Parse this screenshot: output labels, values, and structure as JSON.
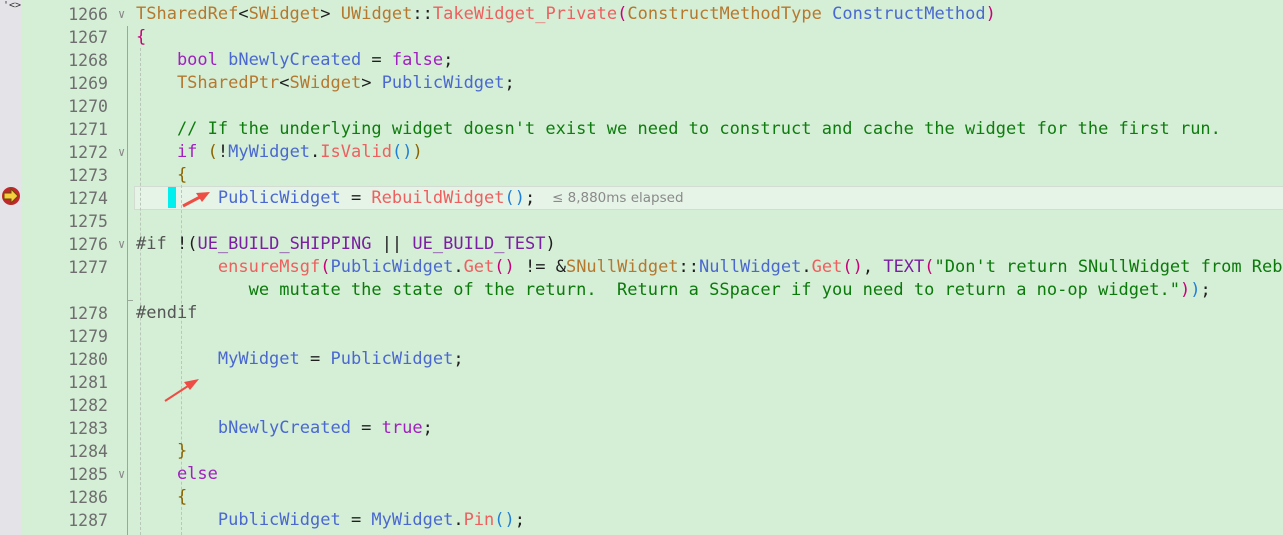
{
  "gutter_tag": "'<>",
  "elapsed_hint": "≤ 8,880ms elapsed",
  "icons": {
    "current_statement": "breakpoint-arrow-icon",
    "fold": "chevron-down-icon",
    "annotation": "red-arrow-icon"
  },
  "colors": {
    "background": "#d5eed6",
    "current_line": "#e6f3e7",
    "cursor_marker": "#00f0f0",
    "annotation_arrow": "#ee4c44"
  },
  "current_line": "1274",
  "lines": [
    {
      "n": "1266",
      "fold": true,
      "tokens": [
        [
          "TSharedRef",
          "t"
        ],
        [
          "<",
          "p"
        ],
        [
          "SWidget",
          "t"
        ],
        [
          "> ",
          "p"
        ],
        [
          "UWidget",
          "t"
        ],
        [
          "::",
          "p"
        ],
        [
          "TakeWidget_Private",
          "f"
        ],
        [
          "(",
          "b1"
        ],
        [
          "ConstructMethodType",
          "t"
        ],
        [
          " ",
          "p"
        ],
        [
          "ConstructMethod",
          "v"
        ],
        [
          ")",
          "b1"
        ]
      ]
    },
    {
      "n": "1267",
      "tokens": [
        [
          "{",
          "b1"
        ]
      ]
    },
    {
      "n": "1268",
      "tokens": [
        [
          "    bool ",
          "k"
        ],
        [
          "bNewlyCreated",
          "v"
        ],
        [
          " = ",
          "p"
        ],
        [
          "false",
          "k"
        ],
        [
          ";",
          "p"
        ]
      ]
    },
    {
      "n": "1269",
      "tokens": [
        [
          "    TSharedPtr",
          "t"
        ],
        [
          "<",
          "p"
        ],
        [
          "SWidget",
          "t"
        ],
        [
          "> ",
          "p"
        ],
        [
          "PublicWidget",
          "v"
        ],
        [
          ";",
          "p"
        ]
      ]
    },
    {
      "n": "1270",
      "tokens": []
    },
    {
      "n": "1271",
      "tokens": [
        [
          "    // If the underlying widget doesn't exist we need to construct and cache the widget for the first run.",
          "c"
        ]
      ]
    },
    {
      "n": "1272",
      "fold": true,
      "tokens": [
        [
          "    if ",
          "k"
        ],
        [
          "(",
          "b2"
        ],
        [
          "!",
          "p"
        ],
        [
          "MyWidget",
          "v"
        ],
        [
          ".",
          "p"
        ],
        [
          "IsValid",
          "f"
        ],
        [
          "()",
          "b3"
        ],
        [
          ")",
          "b2"
        ]
      ]
    },
    {
      "n": "1273",
      "tokens": [
        [
          "    {",
          "b2"
        ]
      ]
    },
    {
      "n": "1274",
      "tokens": [
        [
          "        PublicWidget",
          "v"
        ],
        [
          " = ",
          "p"
        ],
        [
          "RebuildWidget",
          "f"
        ],
        [
          "()",
          "b3"
        ],
        [
          ";",
          "p"
        ]
      ]
    },
    {
      "n": "1275",
      "tokens": []
    },
    {
      "n": "1276",
      "fold": true,
      "tokens": [
        [
          "#if ",
          "pp"
        ],
        [
          "!",
          "p"
        ],
        [
          "(",
          "p"
        ],
        [
          "UE_BUILD_SHIPPING",
          "m"
        ],
        [
          " || ",
          "p"
        ],
        [
          "UE_BUILD_TEST",
          "m"
        ],
        [
          ")",
          "p"
        ]
      ]
    },
    {
      "n": "1277",
      "tokens": [
        [
          "        ensureMsgf",
          "f"
        ],
        [
          "(",
          "b1"
        ],
        [
          "PublicWidget",
          "v"
        ],
        [
          ".",
          "p"
        ],
        [
          "Get",
          "f"
        ],
        [
          "()",
          "b1"
        ],
        [
          " != &",
          "p"
        ],
        [
          "SNullWidget",
          "t"
        ],
        [
          "::",
          "p"
        ],
        [
          "NullWidget",
          "v"
        ],
        [
          ".",
          "p"
        ],
        [
          "Get",
          "f"
        ],
        [
          "()",
          "b1"
        ],
        [
          ", ",
          "p"
        ],
        [
          "TEXT",
          "m"
        ],
        [
          "(",
          "b1"
        ],
        [
          "\"Don't return SNullWidget from Reb",
          "s"
        ]
      ]
    },
    {
      "n": "",
      "tokens": [
        [
          "           we mutate the state of the return.  Return a SSpacer if you need to return a no-op widget.\"",
          "s"
        ],
        [
          ")",
          "b1"
        ],
        [
          ")",
          "b3"
        ],
        [
          ";",
          "p"
        ]
      ]
    },
    {
      "n": "1278",
      "tokens": [
        [
          "#endif",
          "pp"
        ]
      ]
    },
    {
      "n": "1279",
      "tokens": []
    },
    {
      "n": "1280",
      "tokens": [
        [
          "        MyWidget",
          "v"
        ],
        [
          " = ",
          "p"
        ],
        [
          "PublicWidget",
          "v"
        ],
        [
          ";",
          "p"
        ]
      ]
    },
    {
      "n": "1281",
      "tokens": []
    },
    {
      "n": "1282",
      "tokens": []
    },
    {
      "n": "1283",
      "tokens": [
        [
          "        bNewlyCreated",
          "v"
        ],
        [
          " = ",
          "p"
        ],
        [
          "true",
          "k"
        ],
        [
          ";",
          "p"
        ]
      ]
    },
    {
      "n": "1284",
      "tokens": [
        [
          "    }",
          "b2"
        ]
      ]
    },
    {
      "n": "1285",
      "fold": true,
      "tokens": [
        [
          "    else",
          "k"
        ]
      ]
    },
    {
      "n": "1286",
      "tokens": [
        [
          "    {",
          "b2"
        ]
      ]
    },
    {
      "n": "1287",
      "tokens": [
        [
          "        PublicWidget",
          "v"
        ],
        [
          " = ",
          "p"
        ],
        [
          "MyWidget",
          "v"
        ],
        [
          ".",
          "p"
        ],
        [
          "Pin",
          "f"
        ],
        [
          "()",
          "b3"
        ],
        [
          ";",
          "p"
        ]
      ]
    }
  ]
}
